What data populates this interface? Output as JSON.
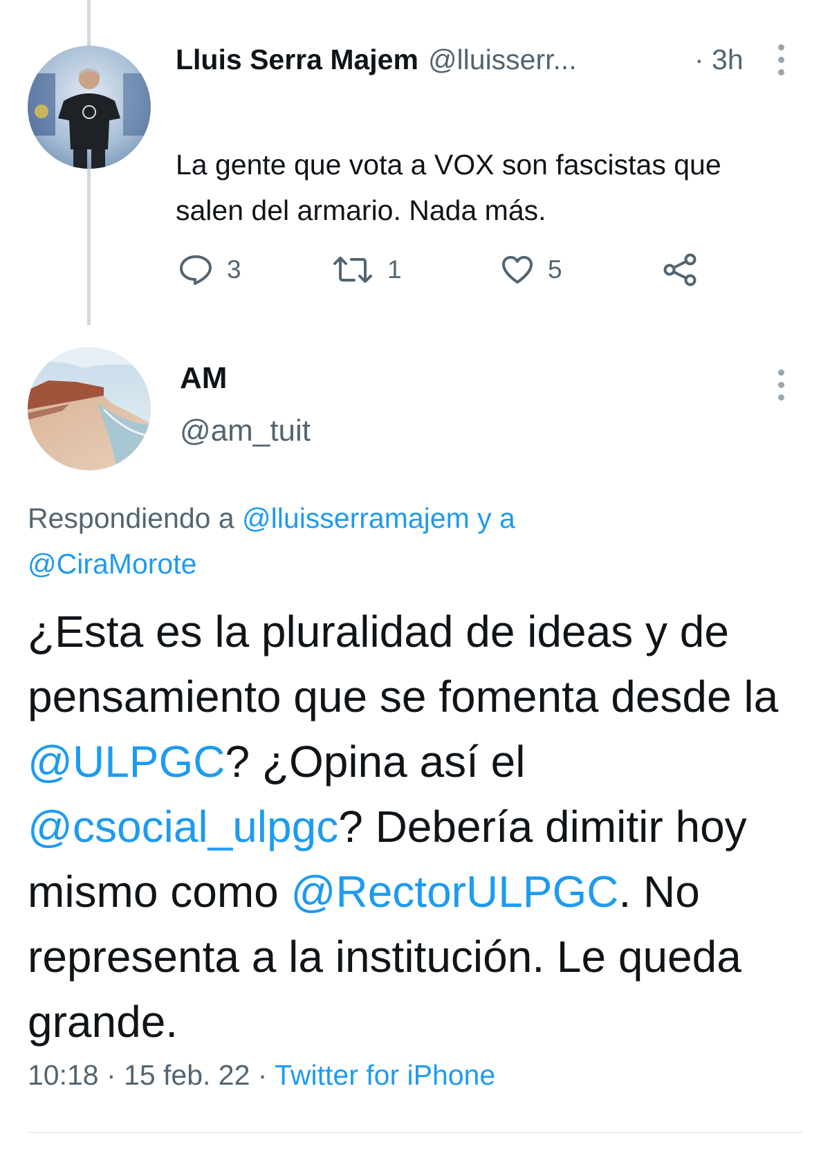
{
  "tweet1": {
    "name": "Lluis Serra Majem",
    "handle": "@lluisserr...",
    "time": "· 3h",
    "text": "La gente que vota a VOX son fascistas que salen del armario. Nada más.",
    "replies": "3",
    "retweets": "1",
    "likes": "5",
    "icons": [
      "reply-icon",
      "retweet-icon",
      "like-icon",
      "share-icon",
      "more-icon"
    ]
  },
  "tweet2": {
    "name": "AM",
    "handle": "@am_tuit",
    "replying_prefix": "Respondiendo a",
    "replying_user1": "@lluisserramajem",
    "replying_joiner": "y a",
    "replying_user2": "@CiraMorote",
    "text_parts": [
      "¿Esta es la pluralidad de ideas y de pensamiento que se fomenta desde la ",
      "@ULPGC",
      "? ¿Opina así el ",
      "@csocial_ulpgc",
      "? Debería dimitir hoy mismo como ",
      "@RectorULPGC",
      ". No representa a la institución. Le queda grande."
    ],
    "timestamp": "10:18 · 15 feb. 22 ·",
    "source": "Twitter for iPhone"
  },
  "colors": {
    "accent": "#1d9bf0",
    "secondary_text": "#536471",
    "primary_text": "#0f1419"
  }
}
